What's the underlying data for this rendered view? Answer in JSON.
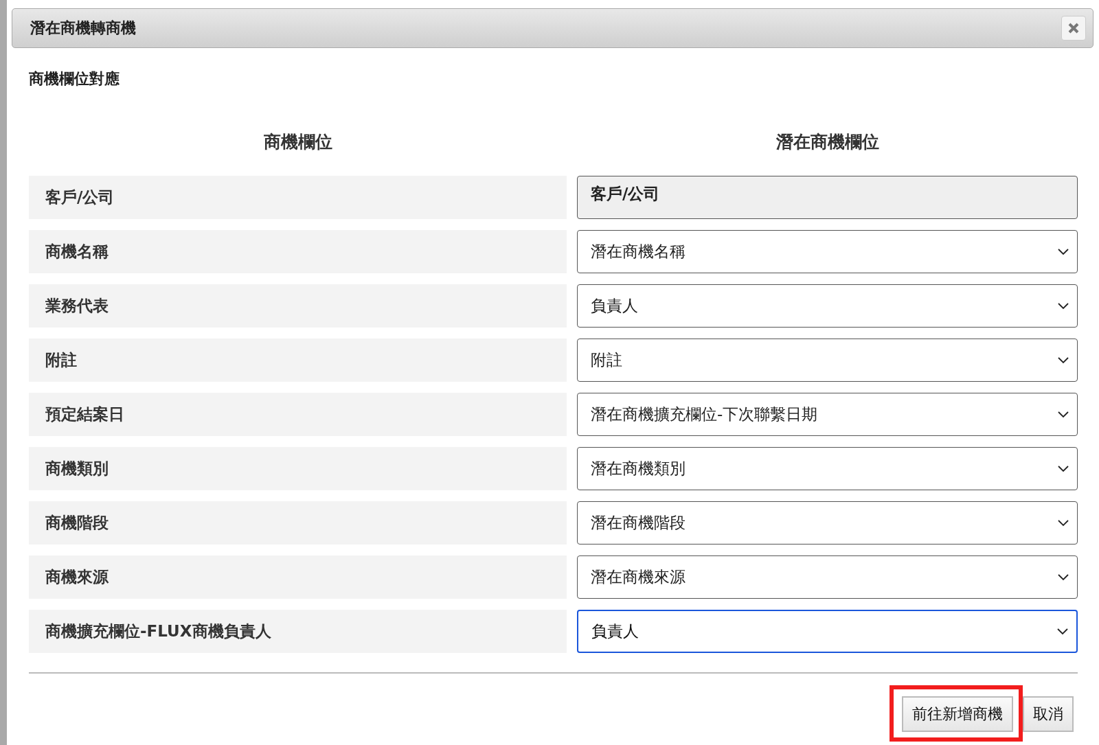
{
  "window": {
    "title": "潛在商機轉商機"
  },
  "section_title": "商機欄位對應",
  "columns": [
    "商機欄位",
    "潛在商機欄位"
  ],
  "rows": [
    {
      "label": "客戶/公司",
      "kind": "readonly",
      "value": "客戶/公司"
    },
    {
      "label": "商機名稱",
      "kind": "select",
      "value": "潛在商機名稱",
      "focused": false
    },
    {
      "label": "業務代表",
      "kind": "select",
      "value": "負責人",
      "focused": false
    },
    {
      "label": "附註",
      "kind": "select",
      "value": "附註",
      "focused": false
    },
    {
      "label": "預定結案日",
      "kind": "select",
      "value": "潛在商機擴充欄位-下次聯繫日期",
      "focused": false
    },
    {
      "label": "商機類別",
      "kind": "select",
      "value": "潛在商機類別",
      "focused": false
    },
    {
      "label": "商機階段",
      "kind": "select",
      "value": "潛在商機階段",
      "focused": false
    },
    {
      "label": "商機來源",
      "kind": "select",
      "value": "潛在商機來源",
      "focused": false
    },
    {
      "label": "商機擴充欄位-FLUX商機負責人",
      "kind": "select",
      "value": "負責人",
      "focused": true
    }
  ],
  "buttons": [
    {
      "label": "前往新增商機",
      "highlighted": true
    },
    {
      "label": "取消",
      "highlighted": false
    }
  ]
}
